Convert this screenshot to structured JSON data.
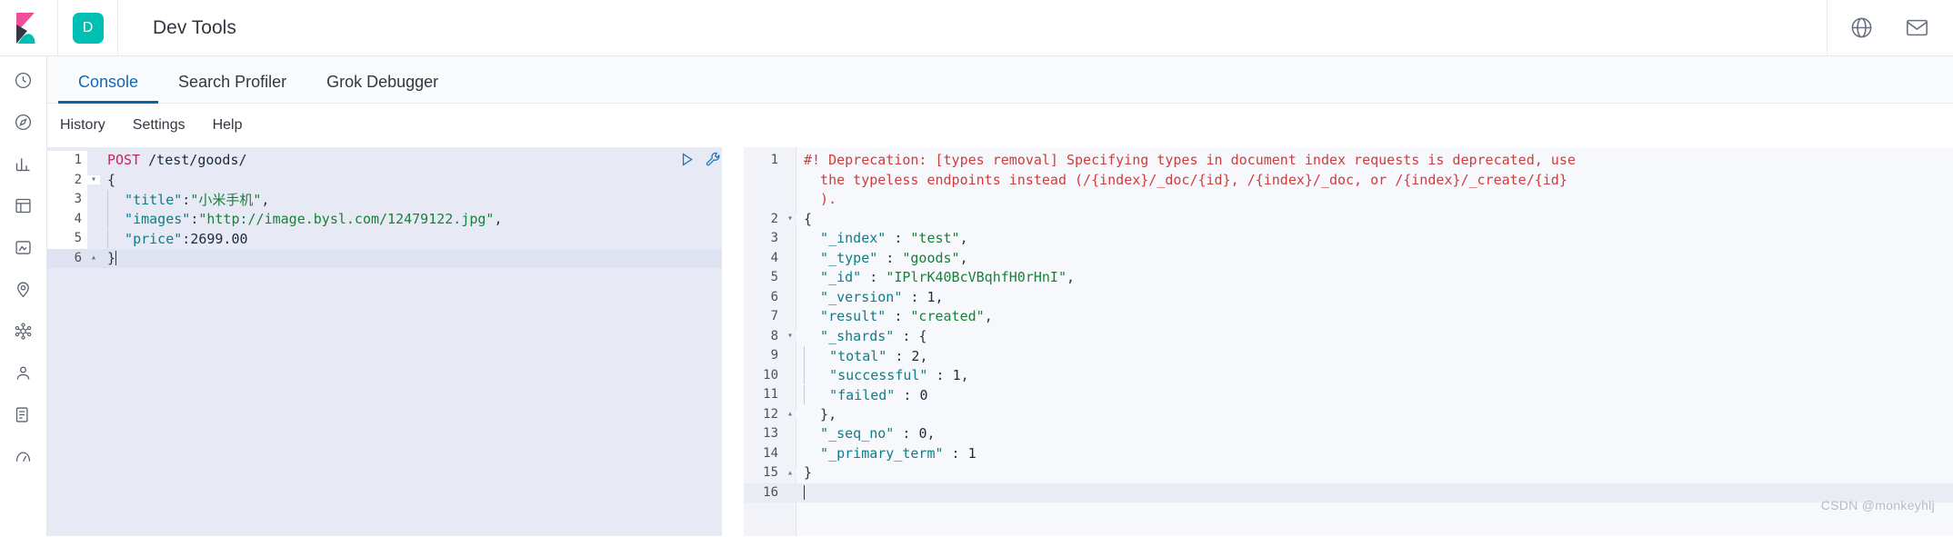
{
  "header": {
    "title": "Dev Tools",
    "space_badge": "D",
    "logo_name": "kibana-logo",
    "icons": [
      {
        "name": "help-globe-icon"
      },
      {
        "name": "mail-icon"
      }
    ]
  },
  "left_rail": {
    "items": [
      {
        "name": "recently-viewed-icon"
      },
      {
        "name": "discover-icon"
      },
      {
        "name": "visualize-icon"
      },
      {
        "name": "dashboard-icon"
      },
      {
        "name": "canvas-icon"
      },
      {
        "name": "maps-icon"
      },
      {
        "name": "machine-learning-icon"
      },
      {
        "name": "infrastructure-icon"
      },
      {
        "name": "logs-icon"
      },
      {
        "name": "apm-icon"
      }
    ]
  },
  "tabs": [
    {
      "label": "Console",
      "active": true
    },
    {
      "label": "Search Profiler",
      "active": false
    },
    {
      "label": "Grok Debugger",
      "active": false
    }
  ],
  "console_toolbar": {
    "links": [
      "History",
      "Settings",
      "Help"
    ]
  },
  "editor_actions": [
    {
      "name": "play-button",
      "label": "Click to send request"
    },
    {
      "name": "wrench-button",
      "label": "Open documentation / auto indent"
    }
  ],
  "request_editor": {
    "name": "request-editor",
    "lines": [
      {
        "num": "1",
        "fold": "",
        "active": false,
        "tokens": [
          {
            "t": "POST",
            "c": "t-method"
          },
          {
            "t": " ",
            "c": "t-punc"
          },
          {
            "t": "/test/goods/",
            "c": "t-url"
          }
        ]
      },
      {
        "num": "2",
        "fold": "▾",
        "active": false,
        "tokens": [
          {
            "t": "{",
            "c": "t-brace"
          }
        ]
      },
      {
        "num": "3",
        "fold": "",
        "active": false,
        "indent": 1,
        "tokens": [
          {
            "t": "  \"title\"",
            "c": "t-key"
          },
          {
            "t": ":",
            "c": "t-punc"
          },
          {
            "t": "\"小米手机\"",
            "c": "t-str"
          },
          {
            "t": ",",
            "c": "t-punc"
          }
        ]
      },
      {
        "num": "4",
        "fold": "",
        "active": false,
        "indent": 1,
        "tokens": [
          {
            "t": "  \"images\"",
            "c": "t-key"
          },
          {
            "t": ":",
            "c": "t-punc"
          },
          {
            "t": "\"http://image.bysl.com/12479122.jpg\"",
            "c": "t-str"
          },
          {
            "t": ",",
            "c": "t-punc"
          }
        ]
      },
      {
        "num": "5",
        "fold": "",
        "active": false,
        "indent": 1,
        "tokens": [
          {
            "t": "  \"price\"",
            "c": "t-key"
          },
          {
            "t": ":",
            "c": "t-punc"
          },
          {
            "t": "2699.00",
            "c": "t-num"
          }
        ]
      },
      {
        "num": "6",
        "fold": "▴",
        "active": true,
        "caret": true,
        "tokens": [
          {
            "t": "}",
            "c": "t-brace"
          }
        ]
      }
    ]
  },
  "response_editor": {
    "name": "response-editor",
    "lines": [
      {
        "num": "1",
        "fold": "",
        "active": false,
        "tokens": [
          {
            "t": "#! Deprecation: [types removal] Specifying types in document index requests is deprecated, use",
            "c": "t-warn"
          }
        ]
      },
      {
        "num": "",
        "fold": "",
        "active": false,
        "tokens": [
          {
            "t": "  the typeless endpoints instead (/{index}/_doc/{id}, /{index}/_doc, or /{index}/_create/{id}",
            "c": "t-warn"
          }
        ]
      },
      {
        "num": "",
        "fold": "",
        "active": false,
        "tokens": [
          {
            "t": "  ).",
            "c": "t-warn"
          }
        ]
      },
      {
        "num": "2",
        "fold": "▾",
        "active": false,
        "tokens": [
          {
            "t": "{",
            "c": "t-brace"
          }
        ]
      },
      {
        "num": "3",
        "fold": "",
        "active": false,
        "tokens": [
          {
            "t": "  \"_index\"",
            "c": "t-key"
          },
          {
            "t": " : ",
            "c": "t-punc"
          },
          {
            "t": "\"test\"",
            "c": "t-str"
          },
          {
            "t": ",",
            "c": "t-punc"
          }
        ]
      },
      {
        "num": "4",
        "fold": "",
        "active": false,
        "tokens": [
          {
            "t": "  \"_type\"",
            "c": "t-key"
          },
          {
            "t": " : ",
            "c": "t-punc"
          },
          {
            "t": "\"goods\"",
            "c": "t-str"
          },
          {
            "t": ",",
            "c": "t-punc"
          }
        ]
      },
      {
        "num": "5",
        "fold": "",
        "active": false,
        "tokens": [
          {
            "t": "  \"_id\"",
            "c": "t-key"
          },
          {
            "t": " : ",
            "c": "t-punc"
          },
          {
            "t": "\"IPlrK40BcVBqhfH0rHnI\"",
            "c": "t-str"
          },
          {
            "t": ",",
            "c": "t-punc"
          }
        ]
      },
      {
        "num": "6",
        "fold": "",
        "active": false,
        "tokens": [
          {
            "t": "  \"_version\"",
            "c": "t-key"
          },
          {
            "t": " : ",
            "c": "t-punc"
          },
          {
            "t": "1",
            "c": "t-num"
          },
          {
            "t": ",",
            "c": "t-punc"
          }
        ]
      },
      {
        "num": "7",
        "fold": "",
        "active": false,
        "tokens": [
          {
            "t": "  \"result\"",
            "c": "t-key"
          },
          {
            "t": " : ",
            "c": "t-punc"
          },
          {
            "t": "\"created\"",
            "c": "t-str"
          },
          {
            "t": ",",
            "c": "t-punc"
          }
        ]
      },
      {
        "num": "8",
        "fold": "▾",
        "active": false,
        "tokens": [
          {
            "t": "  \"_shards\"",
            "c": "t-key"
          },
          {
            "t": " : ",
            "c": "t-punc"
          },
          {
            "t": "{",
            "c": "t-brace"
          }
        ]
      },
      {
        "num": "9",
        "fold": "",
        "active": false,
        "indent": 1,
        "tokens": [
          {
            "t": "   \"total\"",
            "c": "t-key"
          },
          {
            "t": " : ",
            "c": "t-punc"
          },
          {
            "t": "2",
            "c": "t-num"
          },
          {
            "t": ",",
            "c": "t-punc"
          }
        ]
      },
      {
        "num": "10",
        "fold": "",
        "active": false,
        "indent": 1,
        "tokens": [
          {
            "t": "   \"successful\"",
            "c": "t-key"
          },
          {
            "t": " : ",
            "c": "t-punc"
          },
          {
            "t": "1",
            "c": "t-num"
          },
          {
            "t": ",",
            "c": "t-punc"
          }
        ]
      },
      {
        "num": "11",
        "fold": "",
        "active": false,
        "indent": 1,
        "tokens": [
          {
            "t": "   \"failed\"",
            "c": "t-key"
          },
          {
            "t": " : ",
            "c": "t-punc"
          },
          {
            "t": "0",
            "c": "t-num"
          }
        ]
      },
      {
        "num": "12",
        "fold": "▴",
        "active": false,
        "tokens": [
          {
            "t": "  }",
            "c": "t-brace"
          },
          {
            "t": ",",
            "c": "t-punc"
          }
        ]
      },
      {
        "num": "13",
        "fold": "",
        "active": false,
        "tokens": [
          {
            "t": "  \"_seq_no\"",
            "c": "t-key"
          },
          {
            "t": " : ",
            "c": "t-punc"
          },
          {
            "t": "0",
            "c": "t-num"
          },
          {
            "t": ",",
            "c": "t-punc"
          }
        ]
      },
      {
        "num": "14",
        "fold": "",
        "active": false,
        "tokens": [
          {
            "t": "  \"_primary_term\"",
            "c": "t-key"
          },
          {
            "t": " : ",
            "c": "t-punc"
          },
          {
            "t": "1",
            "c": "t-num"
          }
        ]
      },
      {
        "num": "15",
        "fold": "▴",
        "active": false,
        "tokens": [
          {
            "t": "}",
            "c": "t-brace"
          }
        ]
      },
      {
        "num": "16",
        "fold": "",
        "active": true,
        "caret": true,
        "tokens": []
      }
    ]
  },
  "watermark": "CSDN @monkeyhlj",
  "colors": {
    "accent_blue": "#0a65a8",
    "teal": "#00bfb3",
    "pink": "#f04e98",
    "method": "#c7255b",
    "string": "#17803a",
    "key": "#0f7c86",
    "warning": "#cf3c3c",
    "request_bg": "#e7eaf4",
    "response_bg": "#f7f8fc"
  }
}
